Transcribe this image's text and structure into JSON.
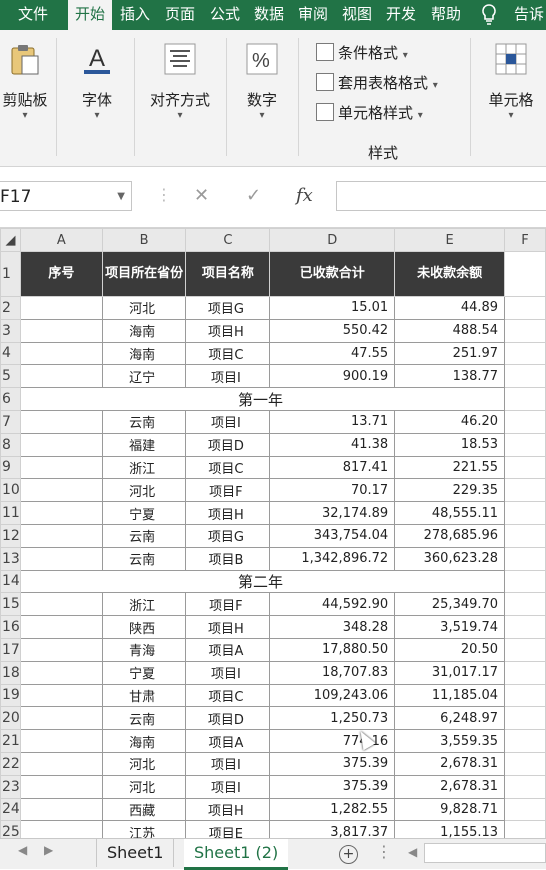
{
  "ribbon_tabs": [
    "文件",
    "开始",
    "插入",
    "页面",
    "公式",
    "数据",
    "审阅",
    "视图",
    "开发",
    "帮助",
    "告诉"
  ],
  "active_tab": "开始",
  "tell_icon": "lightbulb-icon",
  "ribbon": {
    "clipboard": "剪贴板",
    "font": "字体",
    "align": "对齐方式",
    "number": "数字",
    "cond_format": "条件格式",
    "table_format": "套用表格格式",
    "cell_style": "单元格样式",
    "styles_group": "样式",
    "cells": "单元格"
  },
  "formula_bar": {
    "name_box": "F17",
    "fx": "fx",
    "cancel": "✕",
    "enter": "✓"
  },
  "columns": [
    "A",
    "B",
    "C",
    "D",
    "E",
    "F"
  ],
  "header_row": {
    "row": "1",
    "a": "序号",
    "b": "项目所在省份",
    "c": "项目名称",
    "d": "已收款合计",
    "e": "未收款余额"
  },
  "rows": [
    {
      "row": "2",
      "b": "河北",
      "c": "项目G",
      "d": "15.01",
      "e": "44.89"
    },
    {
      "row": "3",
      "b": "海南",
      "c": "项目H",
      "d": "550.42",
      "e": "488.54"
    },
    {
      "row": "4",
      "b": "海南",
      "c": "项目C",
      "d": "47.55",
      "e": "251.97"
    },
    {
      "row": "5",
      "b": "辽宁",
      "c": "项目I",
      "d": "900.19",
      "e": "138.77"
    },
    {
      "row": "6",
      "merged": "第一年"
    },
    {
      "row": "7",
      "b": "云南",
      "c": "项目I",
      "d": "13.71",
      "e": "46.20"
    },
    {
      "row": "8",
      "b": "福建",
      "c": "项目D",
      "d": "41.38",
      "e": "18.53"
    },
    {
      "row": "9",
      "b": "浙江",
      "c": "项目C",
      "d": "817.41",
      "e": "221.55"
    },
    {
      "row": "10",
      "b": "河北",
      "c": "项目F",
      "d": "70.17",
      "e": "229.35"
    },
    {
      "row": "11",
      "b": "宁夏",
      "c": "项目H",
      "d": "32,174.89",
      "e": "48,555.11"
    },
    {
      "row": "12",
      "b": "云南",
      "c": "项目G",
      "d": "343,754.04",
      "e": "278,685.96"
    },
    {
      "row": "13",
      "b": "云南",
      "c": "项目B",
      "d": "1,342,896.72",
      "e": "360,623.28"
    },
    {
      "row": "14",
      "merged": "第二年"
    },
    {
      "row": "15",
      "b": "浙江",
      "c": "项目F",
      "d": "44,592.90",
      "e": "25,349.70"
    },
    {
      "row": "16",
      "b": "陕西",
      "c": "项目H",
      "d": "348.28",
      "e": "3,519.74"
    },
    {
      "row": "17",
      "b": "青海",
      "c": "项目A",
      "d": "17,880.50",
      "e": "20.50"
    },
    {
      "row": "18",
      "b": "宁夏",
      "c": "项目I",
      "d": "18,707.83",
      "e": "31,017.17"
    },
    {
      "row": "19",
      "b": "甘肃",
      "c": "项目C",
      "d": "109,243.06",
      "e": "11,185.04"
    },
    {
      "row": "20",
      "b": "云南",
      "c": "项目D",
      "d": "1,250.73",
      "e": "6,248.97"
    },
    {
      "row": "21",
      "b": "海南",
      "c": "项目A",
      "d": "774.16",
      "e": "3,559.35"
    },
    {
      "row": "22",
      "b": "河北",
      "c": "项目I",
      "d": "375.39",
      "e": "2,678.31"
    },
    {
      "row": "23",
      "b": "河北",
      "c": "项目I",
      "d": "375.39",
      "e": "2,678.31"
    },
    {
      "row": "24",
      "b": "西藏",
      "c": "项目H",
      "d": "1,282.55",
      "e": "9,828.71"
    },
    {
      "row": "25",
      "b": "江苏",
      "c": "项目E",
      "d": "3,817.37",
      "e": "1,155.13"
    }
  ],
  "sheets": [
    "Sheet1",
    "Sheet1 (2)"
  ],
  "active_sheet": "Sheet1 (2)",
  "colors": {
    "accent": "#217346",
    "header_fill": "#3a3a3a"
  }
}
